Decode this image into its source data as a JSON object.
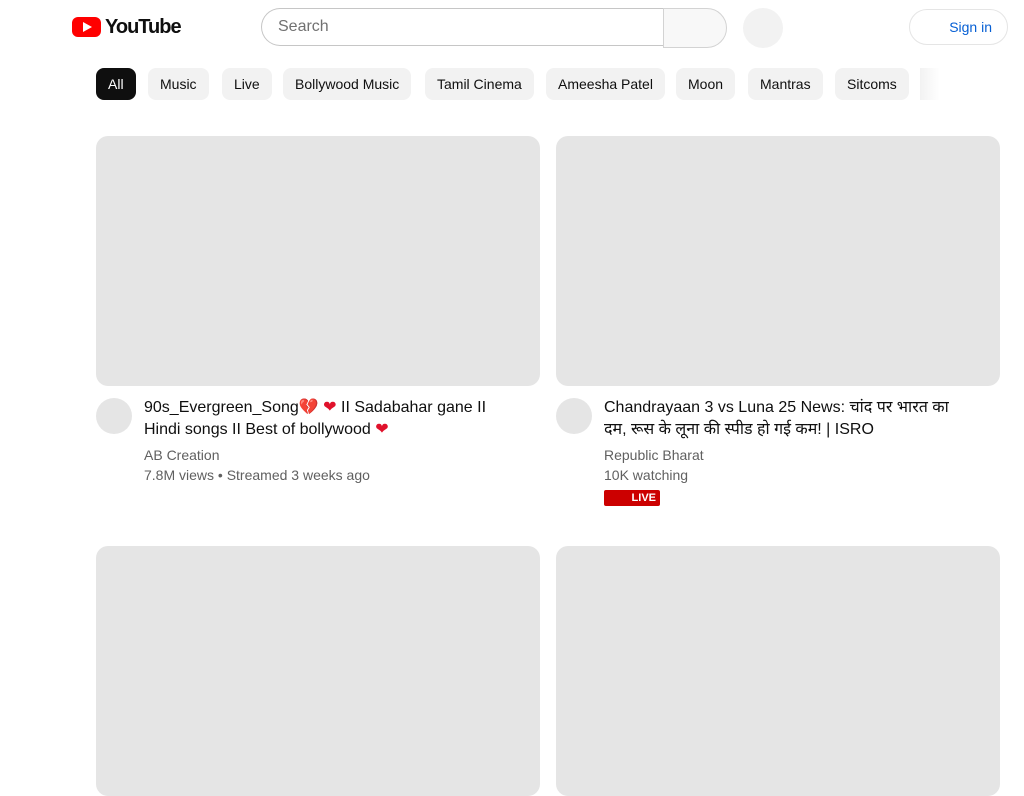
{
  "header": {
    "logo_text": "YouTube",
    "search_placeholder": "Search",
    "signin_label": "Sign in"
  },
  "chips": [
    "All",
    "Music",
    "Live",
    "Bollywood Music",
    "Tamil Cinema",
    "Ameesha Patel",
    "Moon",
    "Mantras",
    "Sitcoms"
  ],
  "videos": [
    {
      "title_parts": [
        "90s_Evergreen_Song",
        " II Sadabahar gane II",
        "Hindi songs II Best of bollywood "
      ],
      "channel": "AB Creation",
      "stats": "7.8M views • Streamed 3 weeks ago"
    },
    {
      "title": "Chandrayaan 3 vs Luna 25 News: चांद पर भारत का दम, रूस के लूना की स्पीड हो गई कम! | ISRO",
      "channel": "Republic Bharat",
      "stats": "10K watching",
      "badge": "LIVE"
    }
  ],
  "colors": {
    "accent": "#ff0000",
    "link": "#065fd4",
    "live": "#cc0000"
  }
}
